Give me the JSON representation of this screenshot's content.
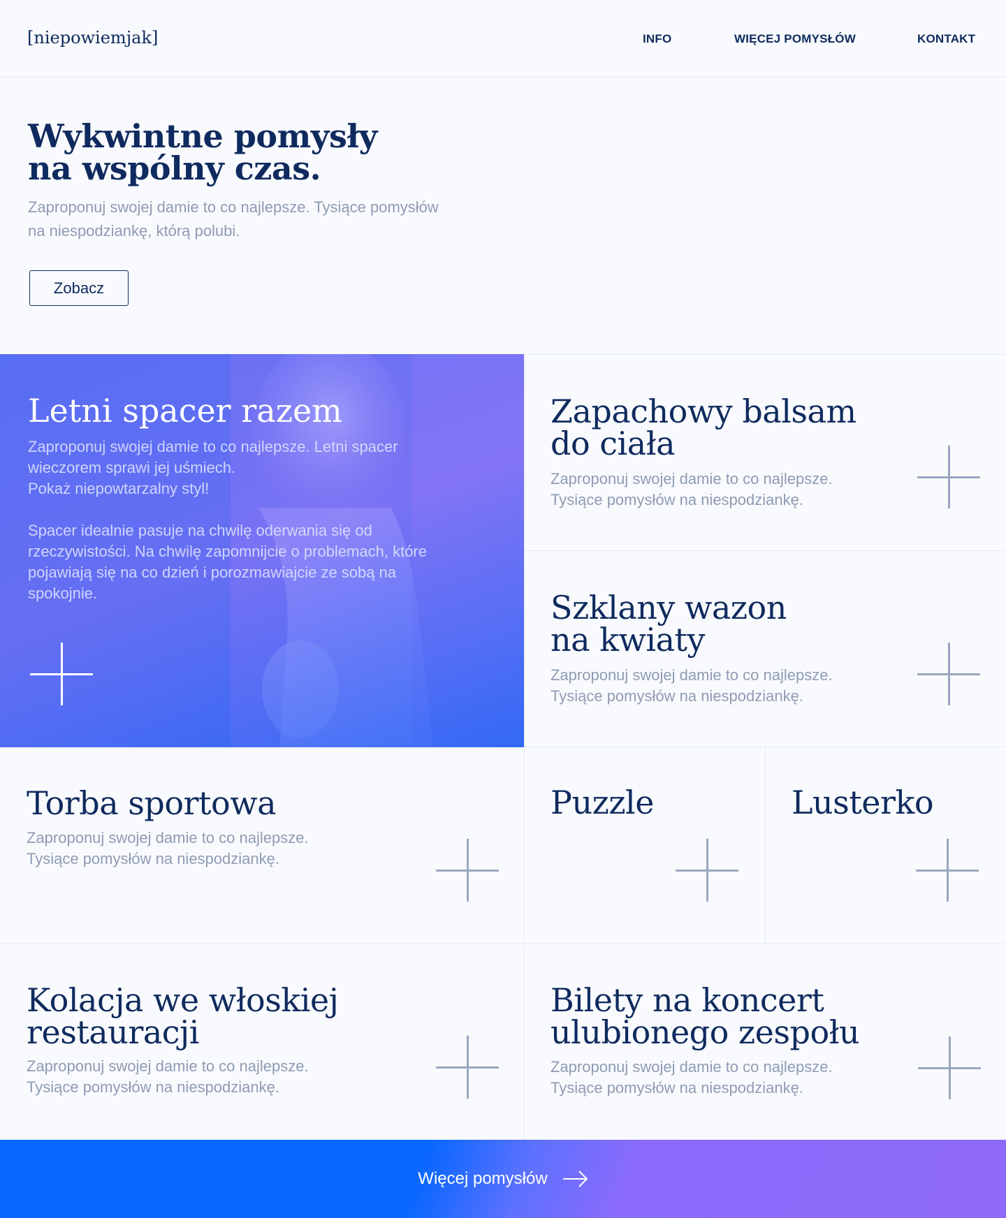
{
  "header": {
    "logo": "[niepowiemjak]",
    "nav": [
      "INFO",
      "WIĘCEJ POMYSŁÓW",
      "KONTAKT"
    ]
  },
  "hero": {
    "title_line1": "Wykwintne pomysły",
    "title_line2": "na wspólny czas.",
    "subtitle_line1": "Zaproponuj swojej damie to co najlepsze. Tysiące pomysłów",
    "subtitle_line2": "na niespodziankę, którą polubi.",
    "button_label": "Zobacz"
  },
  "featured": {
    "title": "Letni spacer razem",
    "p1_line1": "Zaproponuj swojej damie to co najlepsze. Letni spacer",
    "p1_line2": "wieczorem sprawi jej uśmiech.",
    "p1_line3": "Pokaż niepowtarzalny styl!",
    "p2_line1": "Spacer idealnie pasuje na chwilę oderwania się od",
    "p2_line2": "rzeczywistości. Na chwilę zapomnijcie o problemach, które",
    "p2_line3": "pojawiają się na co dzień i porozmawiajcie ze sobą na",
    "p2_line4": "spokojnie."
  },
  "common_desc": {
    "line1": "Zaproponuj swojej damie to co najlepsze.",
    "line2": "Tysiące pomysłów na niespodziankę."
  },
  "cards": {
    "balsam": {
      "line1": "Zapachowy balsam",
      "line2": "do ciała"
    },
    "wazon": {
      "line1": "Szklany wazon",
      "line2": "na kwiaty"
    },
    "torba": {
      "line1": "Torba sportowa"
    },
    "puzzle": {
      "line1": "Puzzle"
    },
    "lusterko": {
      "line1": "Lusterko"
    },
    "kolacja": {
      "line1": "Kolacja we włoskiej",
      "line2": "restauracji"
    },
    "bilety": {
      "line1": "Bilety na koncert",
      "line2": "ulubionego zespołu"
    }
  },
  "footer": {
    "more_label": "Więcej pomysłów"
  },
  "colors": {
    "navy": "#0f2a5e",
    "muted": "#8f9bb3",
    "accent_blue": "#0a67ff",
    "accent_purple": "#8f69fa"
  },
  "icons": [
    "plus-icon",
    "arrow-right-icon"
  ]
}
